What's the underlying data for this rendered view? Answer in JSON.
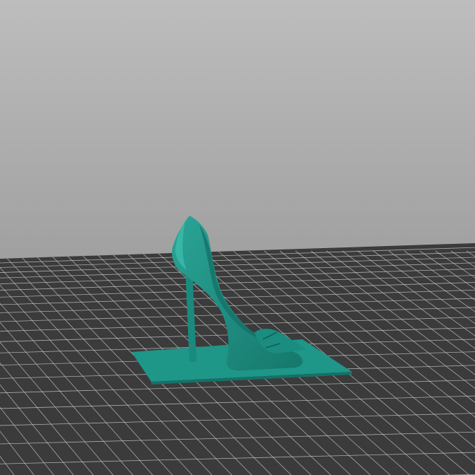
{
  "scene": {
    "background_top_color": "#bdbdbd",
    "background_bottom_color": "#888888",
    "bed_color": "#3b3b3b",
    "grid_line_color": "#cfcfcf",
    "model_color": "#1e9688",
    "model_shadow_color": "#166f66",
    "model_highlight_color": "#35b3a4",
    "model_icon": "high-heel-shoe-icon"
  }
}
